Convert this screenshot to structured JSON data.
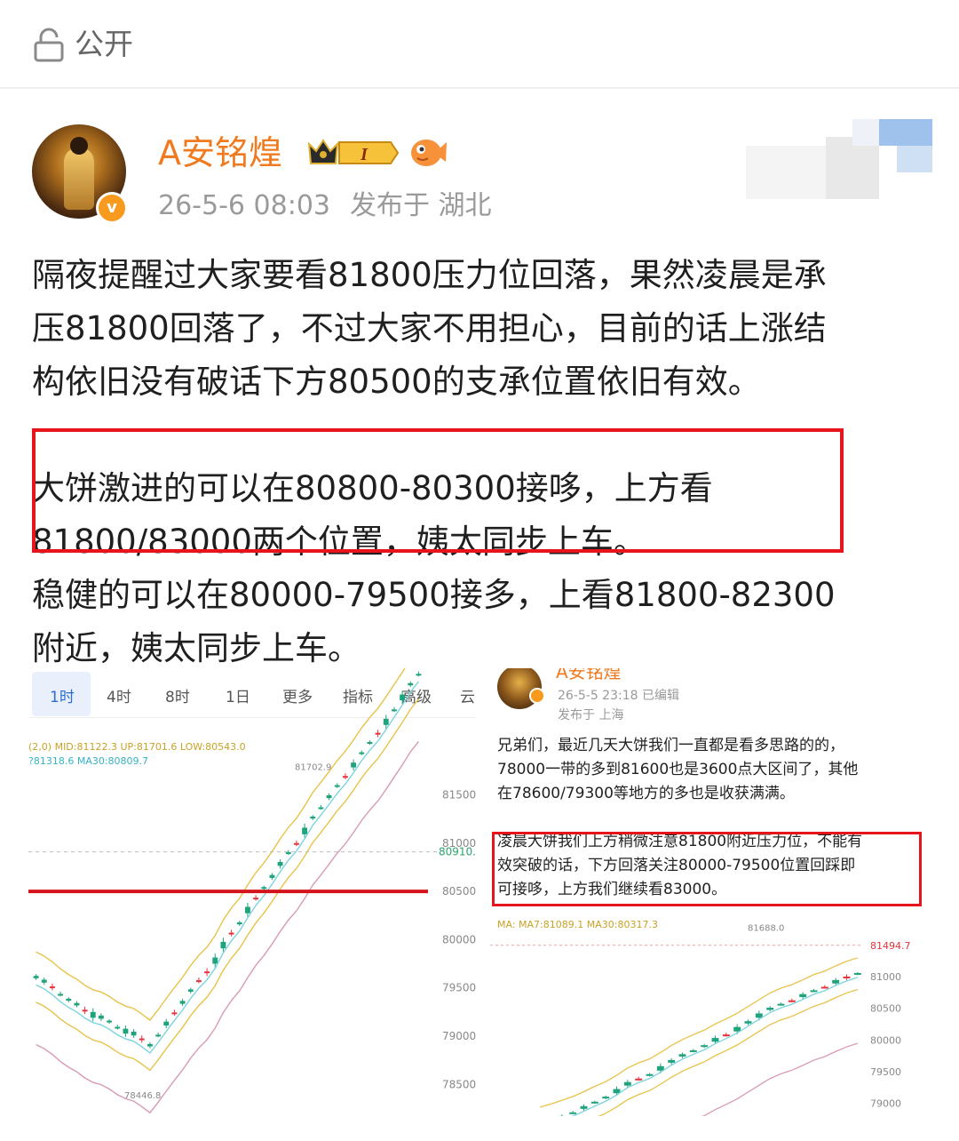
{
  "topbar": {
    "label": "公开",
    "icon": "lock-icon"
  },
  "post": {
    "username": "A安铭煌",
    "time": "26-5-6 08:03",
    "location": "发布于 湖北",
    "verified_icon": "v",
    "paragraph1": [
      "隔夜提醒过大家要看81800压力位回落，果然凌晨是承",
      "压81800回落了，不过大家不用担心，目前的话上涨结",
      "构依旧没有破话下方80500的支承位置依旧有效。"
    ],
    "highlight": [
      "大饼激进的可以在80800-80300接哆，上方看",
      "81800/83000两个位置，姨太同步上车。"
    ],
    "paragraph3": [
      "稳健的可以在80000-79500接多，上看81800-82300",
      "附近，姨太同步上车。"
    ]
  },
  "left_image": {
    "tabs": [
      "1时",
      "4时",
      "8时",
      "1日",
      "更多",
      "指标",
      "高级",
      "云"
    ],
    "indicator_line1": "(2,0) MID:81122.3 UP:81701.6 LOW:80543.0",
    "indicator_line2": "?81318.6 MA30:80809.7",
    "price_labels": [
      "81500",
      "81000",
      "80500",
      "80000",
      "79500",
      "79000",
      "78500"
    ],
    "current_price": "80910.",
    "peak_label": "81702.9",
    "low_label": "78446.8",
    "colors": {
      "up": "#1fa37a",
      "down": "#e8323c",
      "support_line": "#d4141c",
      "boll": "#e8c24a",
      "ma": "#7bd4e0",
      "ma30": "#d89ab8"
    }
  },
  "right_image": {
    "name": "A安铭煌",
    "meta": "26-5-5 23:18  已编辑",
    "location": "发布于 上海",
    "text_lines": [
      "兄弟们，最近几天大饼我们一直都是看多思路的的，",
      "78000一带的多到81600也是3600点大区间了，其他",
      "在78600/79300等地方的多也是收获满满。"
    ],
    "box_lines": [
      "凌晨大饼我们上方稍微注意81800附近压力位，不能有",
      "效突破的话，下方回落关注80000-79500位置回踩即",
      "可接哆，上方我们继续看83000。"
    ],
    "indicator": "MA: MA7:81089.1  MA30:80317.3",
    "price_labels": [
      "81494.7",
      "81000",
      "80500",
      "80000",
      "79500",
      "79000"
    ],
    "peak_label": "81688.0"
  }
}
